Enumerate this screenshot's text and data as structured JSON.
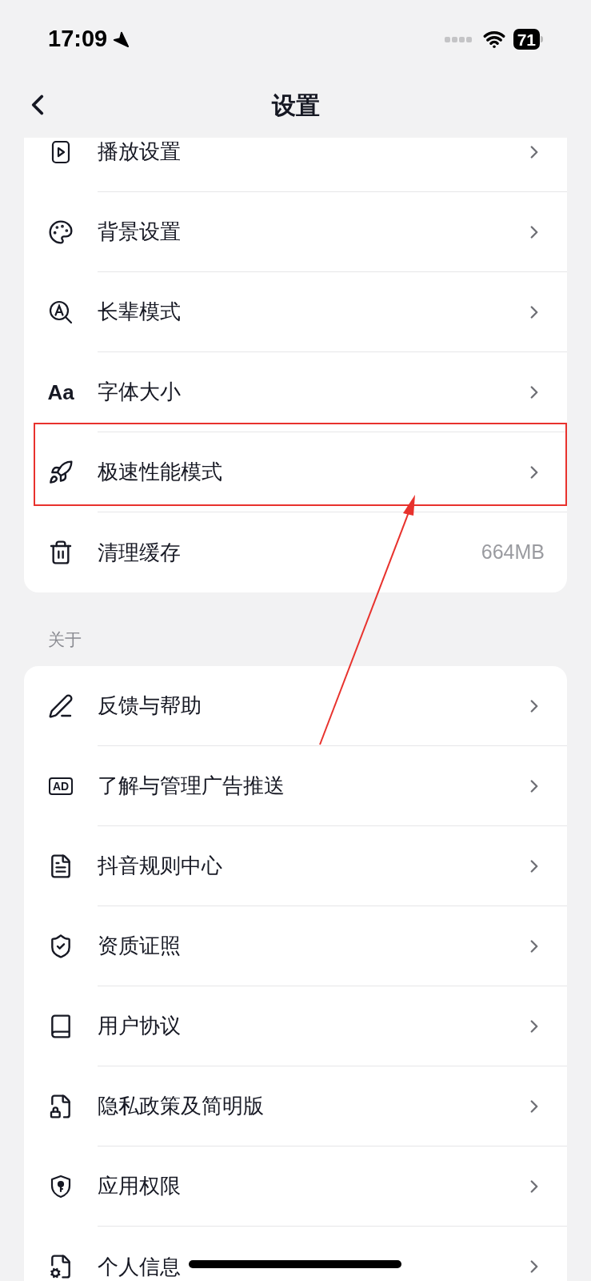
{
  "status_bar": {
    "time": "17:09",
    "battery": "71"
  },
  "nav": {
    "title": "设置"
  },
  "sections": [
    {
      "rows": [
        {
          "label": "播放设置",
          "highlighted": false
        },
        {
          "label": "背景设置",
          "highlighted": false
        },
        {
          "label": "长辈模式",
          "highlighted": false
        },
        {
          "label": "字体大小",
          "icon_text": "Aa",
          "highlighted": false
        },
        {
          "label": "极速性能模式",
          "highlighted": true
        },
        {
          "label": "清理缓存",
          "value": "664MB",
          "highlighted": false
        }
      ]
    },
    {
      "header": "关于",
      "rows": [
        {
          "label": "反馈与帮助",
          "highlighted": false
        },
        {
          "label": "了解与管理广告推送",
          "icon_text": "AD",
          "highlighted": false
        },
        {
          "label": "抖音规则中心",
          "highlighted": false
        },
        {
          "label": "资质证照",
          "highlighted": false
        },
        {
          "label": "用户协议",
          "highlighted": false
        },
        {
          "label": "隐私政策及简明版",
          "highlighted": false
        },
        {
          "label": "应用权限",
          "highlighted": false
        },
        {
          "label": "个人信息",
          "highlighted": false
        }
      ]
    }
  ]
}
